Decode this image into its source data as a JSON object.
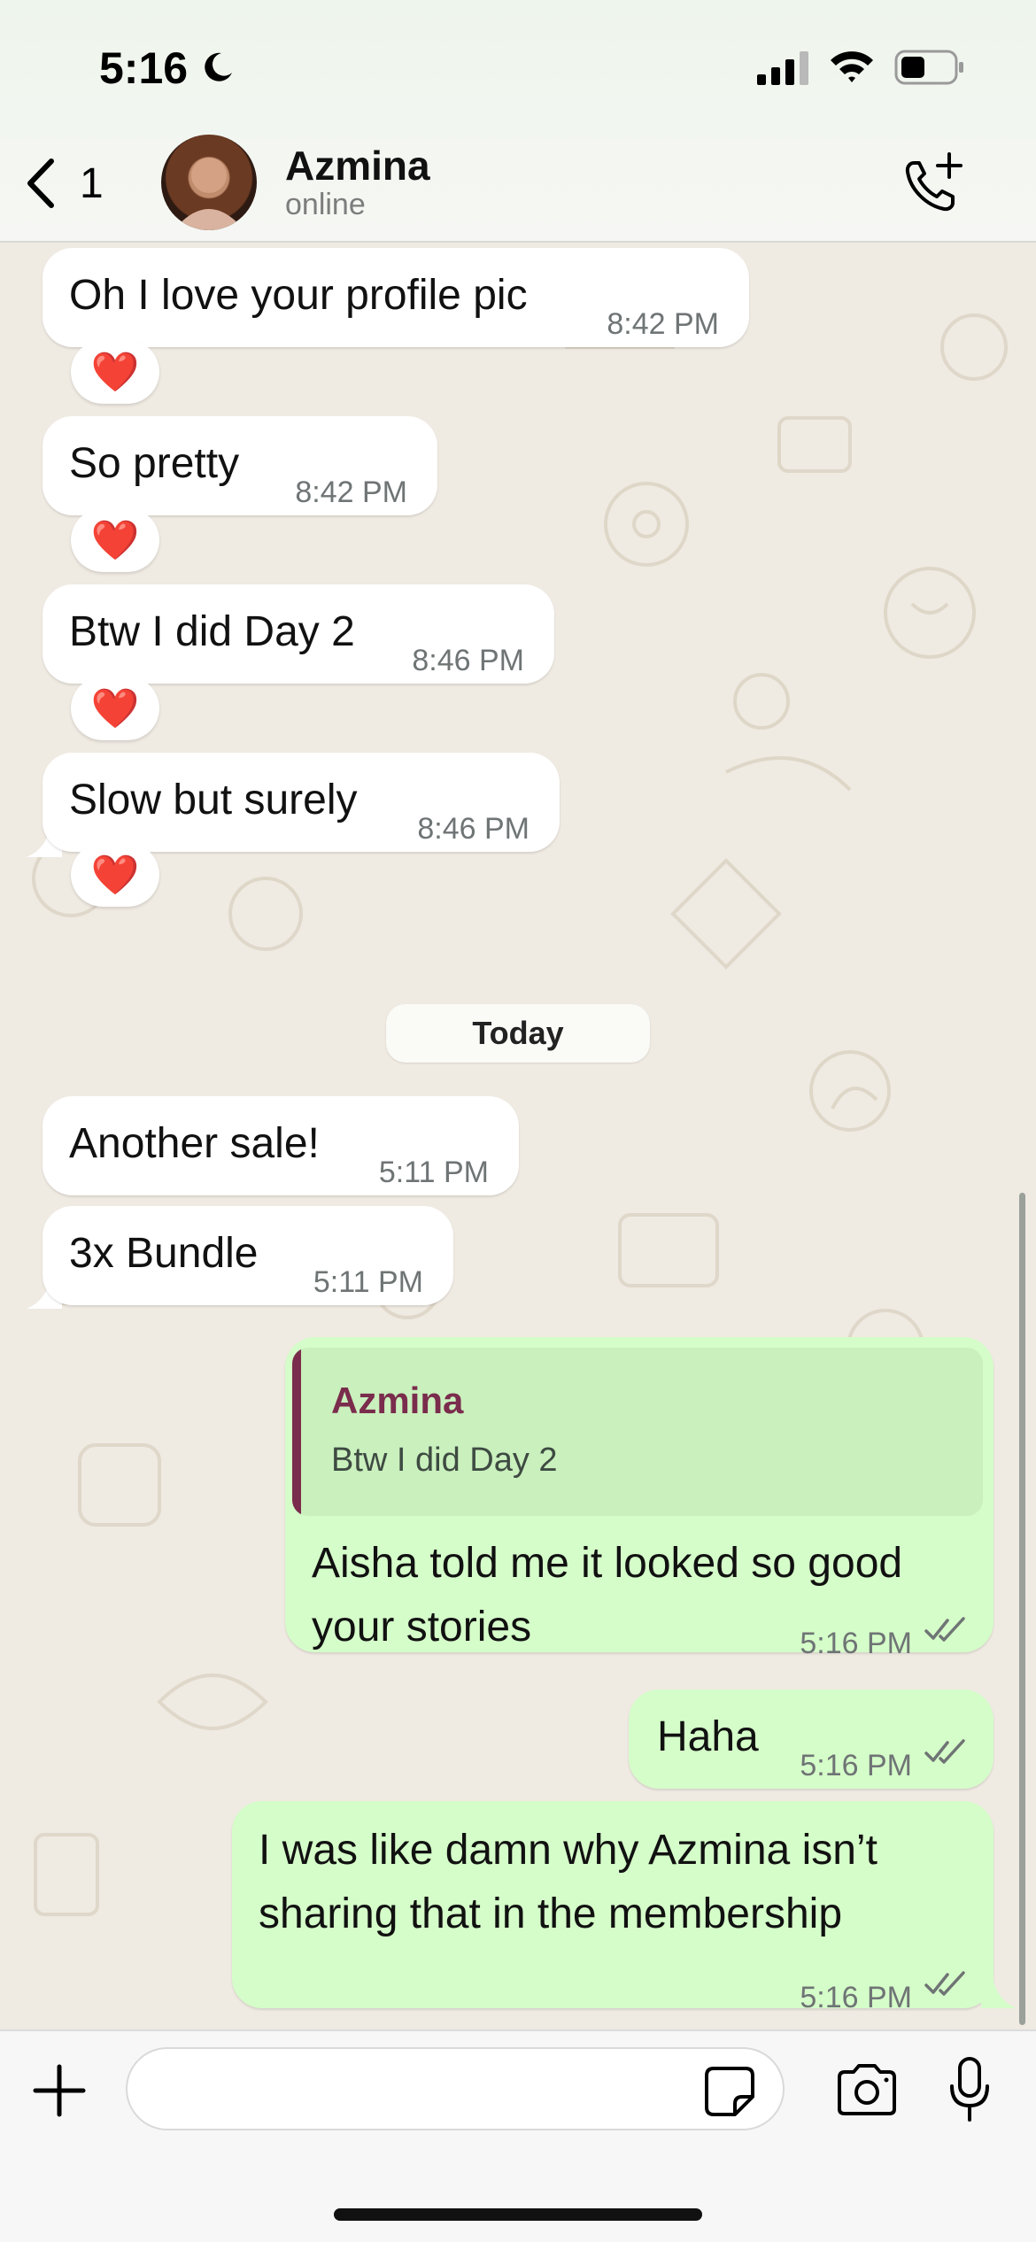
{
  "status_bar": {
    "time": "5:16"
  },
  "header": {
    "back_count": "1",
    "contact_name": "Azmina",
    "contact_status": "online"
  },
  "messages": [
    {
      "text": "Oh I love your profile pic",
      "time": "8:42 PM",
      "reaction": "❤️"
    },
    {
      "text": "So pretty",
      "time": "8:42 PM",
      "reaction": "❤️"
    },
    {
      "text": "Btw I did Day 2",
      "time": "8:46 PM",
      "reaction": "❤️"
    },
    {
      "text": "Slow but surely",
      "time": "8:46 PM",
      "reaction": "❤️"
    },
    {
      "text": "Another sale!",
      "time": "5:11 PM"
    },
    {
      "text": "3x Bundle",
      "time": "5:11 PM"
    }
  ],
  "date_divider": "Today",
  "outgoing": {
    "quote_name": "Azmina",
    "quote_text": "Btw I did Day 2",
    "reply_line1": "Aisha told me it looked so good",
    "reply_line2": "your stories",
    "reply_time": "5:16 PM",
    "haha_text": "Haha",
    "haha_time": "5:16 PM",
    "last_line1": "I was like damn why Azmina isn’t",
    "last_line2": "sharing that in the membership",
    "last_time": "5:16 PM"
  },
  "colors": {
    "incoming_bubble": "#ffffff",
    "outgoing_bubble": "#d5fdc9",
    "quote_accent": "#7a2c4c",
    "chat_background": "#efeae2"
  },
  "icons": [
    "moon-icon",
    "signal-icon",
    "wifi-icon",
    "battery-icon",
    "chevron-left-icon",
    "phone-plus-icon",
    "plus-icon",
    "sticker-icon",
    "camera-icon",
    "microphone-icon",
    "double-check-icon",
    "heart-icon"
  ]
}
